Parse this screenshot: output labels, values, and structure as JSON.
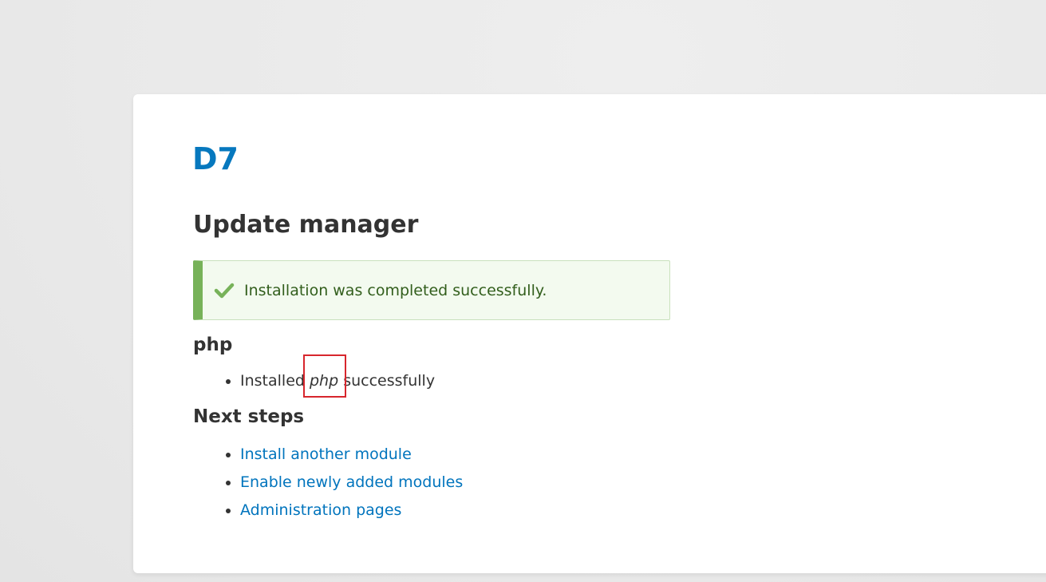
{
  "site": {
    "name": "D7"
  },
  "page": {
    "title": "Update manager"
  },
  "status_message": {
    "icon": "check-icon",
    "text": "Installation was completed successfully.",
    "accent_color": "#77b259"
  },
  "module": {
    "heading": "php",
    "result": {
      "prefix": "Installed",
      "name": "php",
      "suffix": "successfully"
    }
  },
  "next_steps": {
    "heading": "Next steps",
    "links": [
      {
        "label": "Install another module"
      },
      {
        "label": "Enable newly added modules"
      },
      {
        "label": "Administration pages"
      }
    ]
  }
}
